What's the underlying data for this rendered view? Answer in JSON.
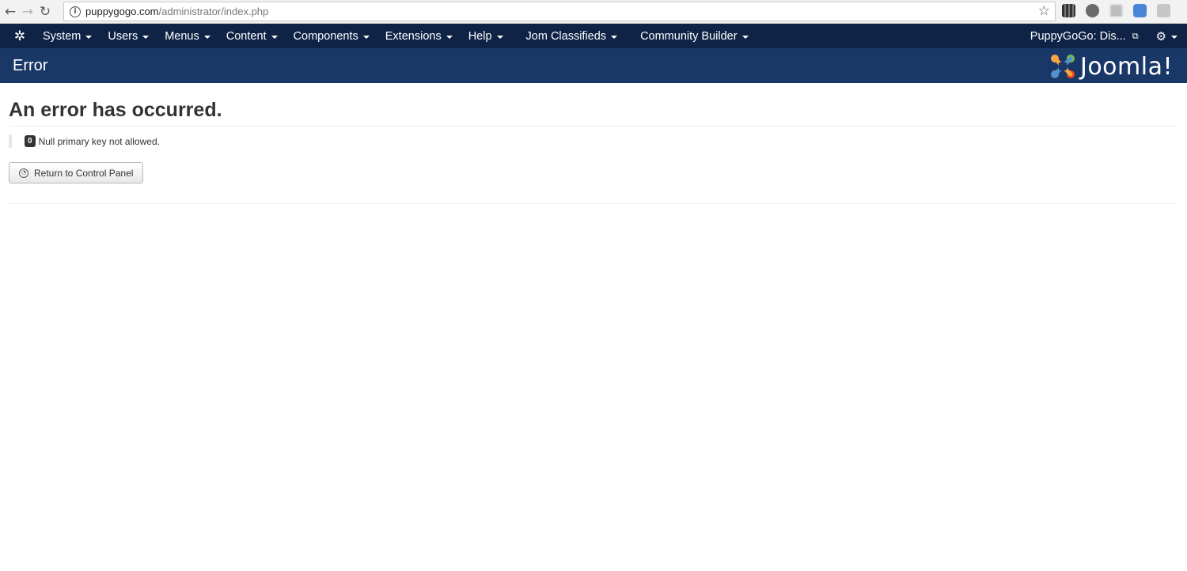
{
  "browser": {
    "url_host": "puppygogo.com",
    "url_path": "/administrator/index.php"
  },
  "nav": {
    "items": [
      {
        "label": "System"
      },
      {
        "label": "Users"
      },
      {
        "label": "Menus"
      },
      {
        "label": "Content"
      },
      {
        "label": "Components"
      },
      {
        "label": "Extensions"
      },
      {
        "label": "Help"
      },
      {
        "label": "Jom Classifieds"
      },
      {
        "label": "Community Builder"
      }
    ],
    "site_link": "PuppyGoGo: Dis..."
  },
  "header": {
    "title": "Error",
    "brand": "Joomla!"
  },
  "main": {
    "error_title": "An error has occurred.",
    "error_code": "0",
    "error_message": "Null primary key not allowed.",
    "return_button": "Return to Control Panel"
  },
  "colors": {
    "nav_bg": "#0f2346",
    "header_bg": "#1a3867"
  }
}
